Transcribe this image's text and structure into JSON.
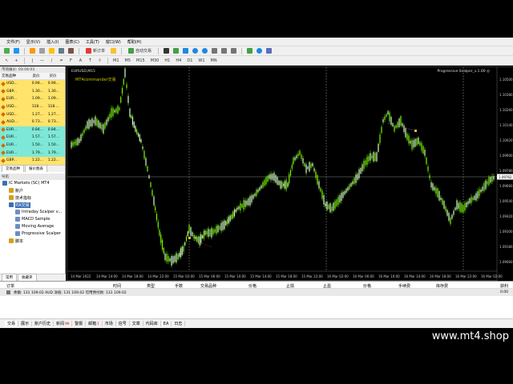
{
  "menu": [
    "文件(F)",
    "显示(V)",
    "插入(I)",
    "图表(C)",
    "工具(T)",
    "窗口(W)",
    "帮助(H)"
  ],
  "toolbar": {
    "new_order": "新订单",
    "autotrading": "自动交易",
    "periods": [
      "M1",
      "M5",
      "M15",
      "M30",
      "H1",
      "H4",
      "D1",
      "W1",
      "MN"
    ]
  },
  "market_watch": {
    "title": "市场报价: 03:04:03",
    "headers": [
      "交易品种",
      "卖价",
      "买价"
    ],
    "rows": [
      {
        "sym": "USD...",
        "bid": "0.94...",
        "ask": "0.94...",
        "bg": "#ffe36a"
      },
      {
        "sym": "GBP...",
        "bid": "1.30...",
        "ask": "1.30...",
        "bg": "#ffe36a"
      },
      {
        "sym": "EUR...",
        "bid": "1.09...",
        "ask": "1.09...",
        "bg": "#ffe36a"
      },
      {
        "sym": "USD...",
        "bid": "118....",
        "ask": "118....",
        "bg": "#ffe36a"
      },
      {
        "sym": "USD...",
        "bid": "1.27...",
        "ask": "1.27...",
        "bg": "#ffe36a"
      },
      {
        "sym": "AUD...",
        "bid": "0.73...",
        "ask": "0.73...",
        "bg": "#ffe36a"
      },
      {
        "sym": "EUR...",
        "bid": "0.84...",
        "ask": "0.84...",
        "bg": "#7ee8d8"
      },
      {
        "sym": "EUR...",
        "bid": "1.57...",
        "ask": "1.57...",
        "bg": "#7ee8d8"
      },
      {
        "sym": "EUR...",
        "bid": "1.50...",
        "ask": "1.50...",
        "bg": "#7ee8d8"
      },
      {
        "sym": "EUR...",
        "bid": "1.79...",
        "ask": "1.79...",
        "bg": "#7ee8d8"
      },
      {
        "sym": "GBP...",
        "bid": "1.22...",
        "ask": "1.22...",
        "bg": "#ffe36a"
      }
    ],
    "tabs": [
      "交易品种",
      "报价图表"
    ]
  },
  "navigator": {
    "title": "导航",
    "items": [
      {
        "label": "IC Markets (SC) MT4",
        "indent": 0,
        "color": "#3b6fb6"
      },
      {
        "label": "账户",
        "indent": 1,
        "color": "#d4a017"
      },
      {
        "label": "技术指标",
        "indent": 1,
        "color": "#d4a017"
      },
      {
        "label": "EA交易",
        "indent": 1,
        "color": "#3b6fb6",
        "selected": true
      },
      {
        "label": "Intraday Scalper v...",
        "indent": 2,
        "color": "#6a8fc0"
      },
      {
        "label": "MACD Sample",
        "indent": 2,
        "color": "#6a8fc0"
      },
      {
        "label": "Moving Average",
        "indent": 2,
        "color": "#6a8fc0"
      },
      {
        "label": "Progressive Scalper",
        "indent": 2,
        "color": "#6a8fc0"
      },
      {
        "label": "脚本",
        "indent": 1,
        "color": "#d4a017"
      }
    ],
    "tabs": [
      "常用",
      "收藏夹"
    ]
  },
  "chart": {
    "symbol_title": "EURUSD,M15",
    "ea_label": "MT4commander交易",
    "ea_name": "Progressive Scalper_v.1.00 ◎",
    "prices": [
      "1.10500",
      "1.10380",
      "1.10260",
      "1.10140",
      "1.10020",
      "1.09900",
      "1.09780",
      "1.09660",
      "1.09540",
      "1.09420",
      "1.09300",
      "1.09180",
      "1.09060"
    ],
    "current_price": "1.09762",
    "times": [
      "14 Mar 2022",
      "14 Mar 14:00",
      "14 Mar 18:00",
      "14 Mar 22:00",
      "15 Mar 02:00",
      "15 Mar 06:00",
      "15 Mar 10:00",
      "15 Mar 14:00",
      "15 Mar 18:00",
      "15 Mar 22:00",
      "16 Mar 02:00",
      "16 Mar 06:00",
      "16 Mar 10:00",
      "16 Mar 14:00",
      "16 Mar 18:00",
      "16 Mar 22:00",
      "16 Mar 02:00"
    ]
  },
  "terminal": {
    "headers": [
      "订单",
      "时间",
      "类型",
      "手数",
      "交易品种",
      "价格",
      "止损",
      "止盈",
      "价格",
      "手续费",
      "库存费",
      "获利"
    ],
    "balance_line": "余额: 131 109.02 AUD  净值: 131 109.02  可用预付款: 131 109.02",
    "balance_right": "0.00",
    "tabs": [
      "交易",
      "展示",
      "账户历史",
      "新闻",
      "警报",
      "邮箱",
      "市场",
      "信号",
      "文章",
      "代码库",
      "EA",
      "日志"
    ],
    "badges": {
      "新闻": "99",
      "邮箱": "1"
    }
  },
  "watermark": "www.mt4.shop"
}
